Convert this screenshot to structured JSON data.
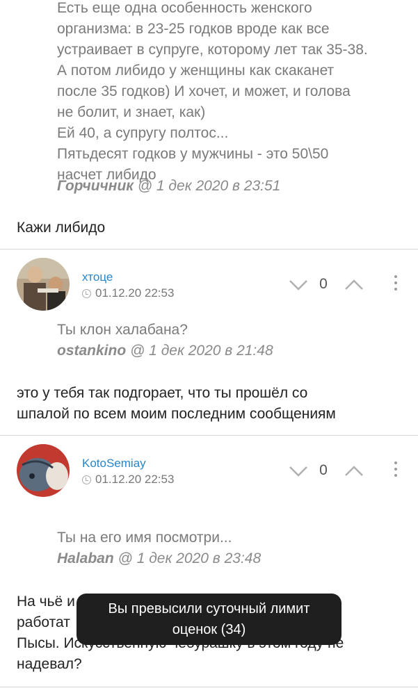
{
  "quote1": {
    "lines": [
      "Есть еще одна особенность женского",
      "организма: в 23-25 годков вроде как все",
      "устраивает в супруге, которому лет так 35-38.",
      "А потом либидо у женщины как скаканет",
      "после 35 годков) И хочет, и может, и голова",
      "не болит, и знает, как)",
      "Ей 40, а супругу полтос...",
      "Пятьдесят годков у мужчины - это 50\\50",
      "насчет либидо"
    ],
    "author": "Горчичник",
    "date": " @ 1 дек 2020 в 23:51"
  },
  "reply1": "Кажи либидо",
  "comment1": {
    "username": "хтоце",
    "time": "01.12.20 22:53",
    "score": "0",
    "quote_text": "Ты клон халабана?",
    "quote_author": "ostankino",
    "quote_date": " @ 1 дек 2020 в 21:48",
    "body": [
      "это у тебя так подгорает, что ты прошёл со",
      "шпалой по всем моим последним сообщениям"
    ]
  },
  "comment2": {
    "username": "KotoSemiay",
    "time": "01.12.20 22:53",
    "score": "0",
    "quote_text": "Ты на его имя посмотри...",
    "quote_author": "Halaban",
    "quote_date": " @ 1 дек 2020 в 23:48",
    "body": [
      "На чьё и                                    м",
      "работат",
      "Пысы. Искусственную чебурашку в этом году не",
      "надевал?"
    ]
  },
  "toast": {
    "line1": "Вы превысили суточный лимит",
    "line2": "оценок (34)"
  },
  "icons": {
    "vote_down": "chevron-down-icon",
    "vote_up": "chevron-up-icon",
    "more": "more-vertical-icon",
    "clock": "clock-icon"
  },
  "colors": {
    "username": "#2a86c9",
    "toast_bg": "#1f1f1f",
    "quote_text": "#7a7a7a"
  }
}
